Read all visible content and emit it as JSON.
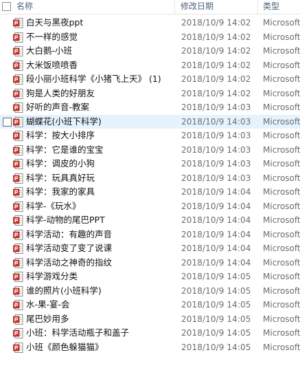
{
  "header": {
    "name_label": "名称",
    "date_label": "修改日期",
    "type_label": "类型"
  },
  "colors": {
    "header_text": "#4c607a",
    "selected_row": "#e5f3ff",
    "icon_red": "#c8372d"
  },
  "icons": {
    "file": "ppt-file-icon"
  },
  "files": [
    {
      "name": "白天与黑夜ppt",
      "date": "2018/10/9 14:02",
      "type": "Microsoft"
    },
    {
      "name": "不一样的感觉",
      "date": "2018/10/9 14:02",
      "type": "Microsoft"
    },
    {
      "name": "大白鹅-小班",
      "date": "2018/10/9 14:02",
      "type": "Microsoft"
    },
    {
      "name": "大米饭喷喷香",
      "date": "2018/10/9 14:02",
      "type": "Microsoft"
    },
    {
      "name": "段小丽小班科学《小猪飞上天》 (1)",
      "date": "2018/10/9 14:02",
      "type": "Microsoft"
    },
    {
      "name": "狗是人类的好朋友",
      "date": "2018/10/9 14:02",
      "type": "Microsoft"
    },
    {
      "name": "好听的声音-教案",
      "date": "2018/10/9 14:03",
      "type": "Microsoft"
    },
    {
      "name": "蝴蝶花(小班下科学)",
      "date": "2018/10/9 14:03",
      "type": "Microsoft"
    },
    {
      "name": "科学：按大小排序",
      "date": "2018/10/9 14:03",
      "type": "Microsoft"
    },
    {
      "name": "科学：它是谁的宝宝",
      "date": "2018/10/9 14:03",
      "type": "Microsoft"
    },
    {
      "name": "科学：调皮的小狗",
      "date": "2018/10/9 14:03",
      "type": "Microsoft"
    },
    {
      "name": "科学：玩具真好玩",
      "date": "2018/10/9 14:03",
      "type": "Microsoft"
    },
    {
      "name": "科学：我家的家具",
      "date": "2018/10/9 14:04",
      "type": "Microsoft"
    },
    {
      "name": "科学-《玩水》",
      "date": "2018/10/9 14:04",
      "type": "Microsoft"
    },
    {
      "name": "科学-动物的尾巴PPT",
      "date": "2018/10/9 14:04",
      "type": "Microsoft"
    },
    {
      "name": "科学活动：有趣的声音",
      "date": "2018/10/9 14:04",
      "type": "Microsoft"
    },
    {
      "name": "科学活动变了变了说课",
      "date": "2018/10/9 14:04",
      "type": "Microsoft"
    },
    {
      "name": "科学活动之神奇的指纹",
      "date": "2018/10/9 14:04",
      "type": "Microsoft"
    },
    {
      "name": "科学游戏分类",
      "date": "2018/10/9 14:05",
      "type": "Microsoft"
    },
    {
      "name": "谁的照片(小班科学)",
      "date": "2018/10/9 14:05",
      "type": "Microsoft"
    },
    {
      "name": "水-果-宴-会",
      "date": "2018/10/9 14:05",
      "type": "Microsoft"
    },
    {
      "name": "尾巴妙用多",
      "date": "2018/10/9 14:05",
      "type": "Microsoft"
    },
    {
      "name": "小班：科学活动瓶子和盖子",
      "date": "2018/10/9 14:05",
      "type": "Microsoft"
    },
    {
      "name": "小班《颜色躲猫猫》",
      "date": "2018/10/9 14:05",
      "type": "Microsoft"
    }
  ],
  "selected_index": 7
}
